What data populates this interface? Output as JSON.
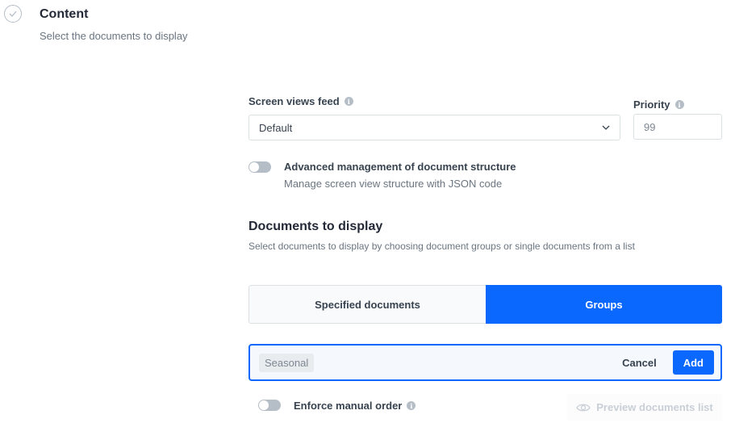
{
  "section": {
    "icon": "check-circle-icon",
    "title": "Content",
    "subtitle": "Select the documents to display"
  },
  "feed": {
    "label": "Screen views feed",
    "value": "Default"
  },
  "priority": {
    "label": "Priority",
    "value": "99"
  },
  "advanced": {
    "enabled": false,
    "label": "Advanced management of document structure",
    "description": "Manage screen view structure with JSON code"
  },
  "documents": {
    "title": "Documents to display",
    "description": "Select documents to display by choosing document groups or single documents from a list",
    "tabs": [
      {
        "label": "Specified documents",
        "active": false
      },
      {
        "label": "Groups",
        "active": true
      }
    ],
    "selected_group": "Seasonal",
    "cancel_label": "Cancel",
    "add_label": "Add"
  },
  "manual_order": {
    "enabled": false,
    "label": "Enforce manual order"
  },
  "preview": {
    "label": "Preview documents list",
    "disabled": true
  },
  "colors": {
    "accent": "#0b68ff"
  }
}
